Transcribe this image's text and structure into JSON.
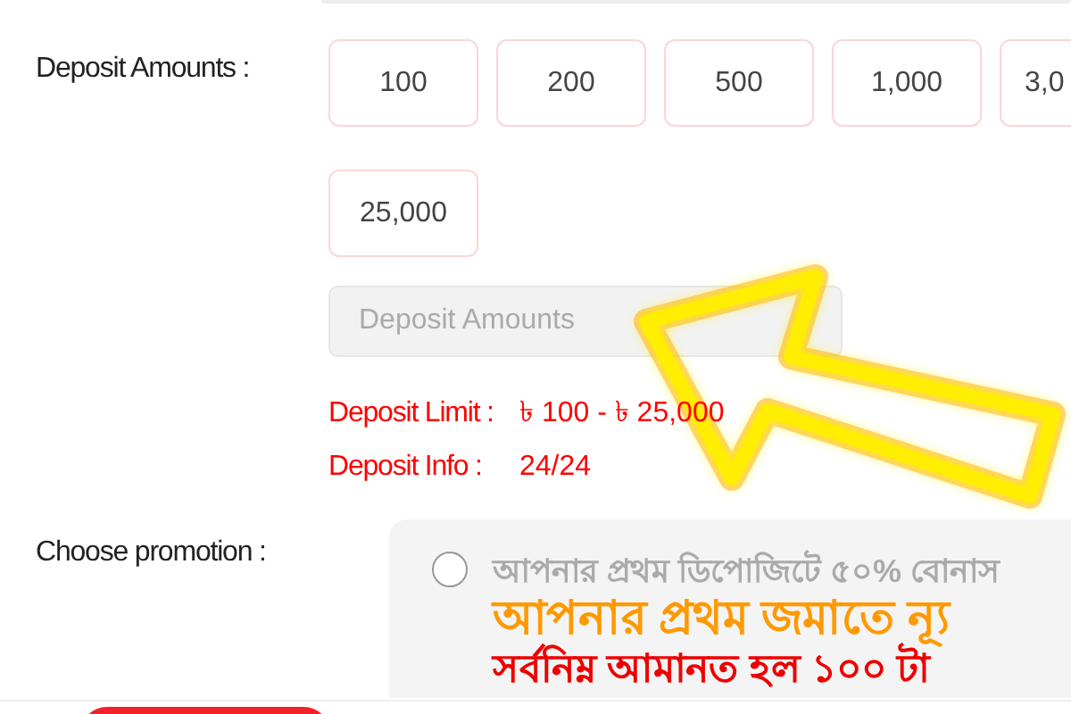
{
  "deposit_amounts": {
    "label": "Deposit Amounts :",
    "rows": [
      [
        "100",
        "200",
        "500",
        "1,000",
        "3,0"
      ],
      [
        "25,000"
      ]
    ],
    "input": {
      "placeholder": "Deposit Amounts"
    }
  },
  "deposit_limit": {
    "label": "Deposit Limit :",
    "value": "৳ 100 - ৳ 25,000"
  },
  "deposit_info": {
    "label": "Deposit Info :",
    "value": "24/24"
  },
  "promotion": {
    "label": "Choose promotion :",
    "options": [
      {
        "selected": false,
        "title": "আপনার প্রথম ডিপোজিটে ৫০% বোনাস",
        "headline": "আপনার প্রথম জমাতে ন্যূ",
        "note": "সর্বনিম্ন আমানত হল ১০০ টা"
      }
    ]
  }
}
